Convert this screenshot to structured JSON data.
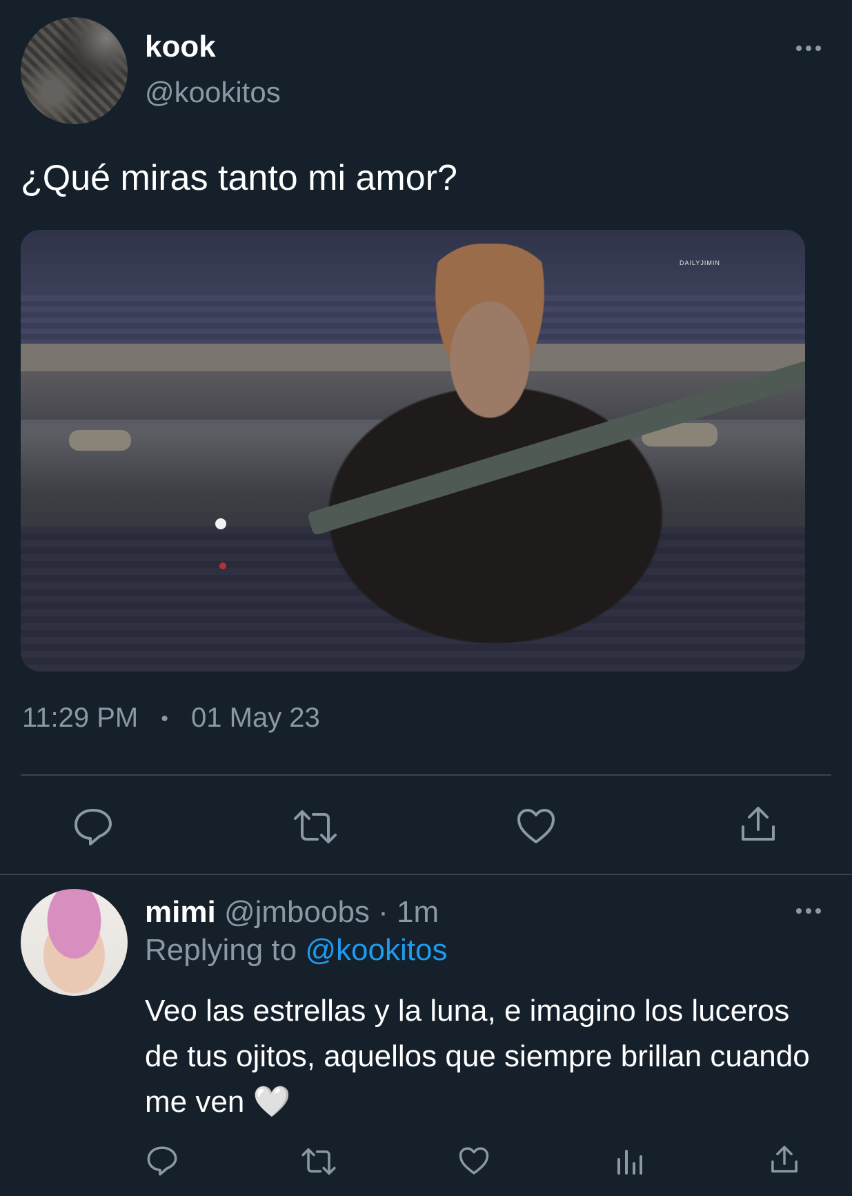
{
  "tweet": {
    "author_name": "kook",
    "author_handle": "@kookitos",
    "text": "¿Qué miras tanto mi amor?",
    "time": "11:29 PM",
    "separator": "•",
    "date": "01 May 23",
    "image_watermark": "DAILYJIMIN",
    "more_icon": "more-horizontal-icon"
  },
  "tweet_actions": [
    {
      "name": "reply",
      "icon": "reply-icon"
    },
    {
      "name": "retweet",
      "icon": "retweet-icon"
    },
    {
      "name": "like",
      "icon": "heart-icon"
    },
    {
      "name": "share",
      "icon": "share-icon"
    }
  ],
  "reply": {
    "author_name": "mimi",
    "author_handle": "@jmboobs",
    "dot": "·",
    "age": "1m",
    "replying_prefix": "Replying to",
    "replying_handle": "@kookitos",
    "text": "Veo las estrellas y la luna, e imagino los luceros de tus ojitos, aquellos que siempre brillan cuando me ven 🤍",
    "more_icon": "more-horizontal-icon"
  },
  "reply_actions": [
    {
      "name": "reply",
      "icon": "reply-icon"
    },
    {
      "name": "retweet",
      "icon": "retweet-icon"
    },
    {
      "name": "like",
      "icon": "heart-icon"
    },
    {
      "name": "analytics",
      "icon": "analytics-icon"
    },
    {
      "name": "share",
      "icon": "share-icon"
    }
  ],
  "colors": {
    "background": "#15202b",
    "secondary_text": "#8b98a5",
    "divider": "#38444d",
    "mention": "#1d9bf0"
  }
}
